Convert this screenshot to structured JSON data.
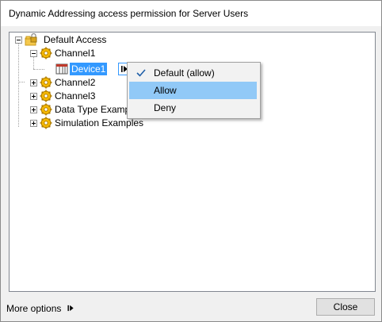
{
  "window": {
    "title": "Dynamic Addressing access permission for Server Users"
  },
  "tree": {
    "root": {
      "label": "Default Access",
      "icon": "lock-folder-icon"
    },
    "channel1": {
      "label": "Channel1",
      "icon": "gear-icon"
    },
    "device1": {
      "label": "Device1",
      "icon": "device-icon"
    },
    "channel2": {
      "label": "Channel2",
      "icon": "gear-icon"
    },
    "channel3": {
      "label": "Channel3",
      "icon": "gear-icon"
    },
    "data_type_examples": {
      "label": "Data Type Examples",
      "icon": "gear-icon"
    },
    "simulation_examples": {
      "label": "Simulation Examples",
      "icon": "gear-icon"
    }
  },
  "context_menu": {
    "items": [
      {
        "label": "Default (allow)",
        "checked": true
      },
      {
        "label": "Allow",
        "highlighted": true
      },
      {
        "label": "Deny"
      }
    ]
  },
  "footer": {
    "more_options_label": "More options",
    "close_label": "Close"
  },
  "colors": {
    "selection": "#3399ff",
    "menu_hover": "#91c9f7",
    "gear": "#f5b800"
  }
}
